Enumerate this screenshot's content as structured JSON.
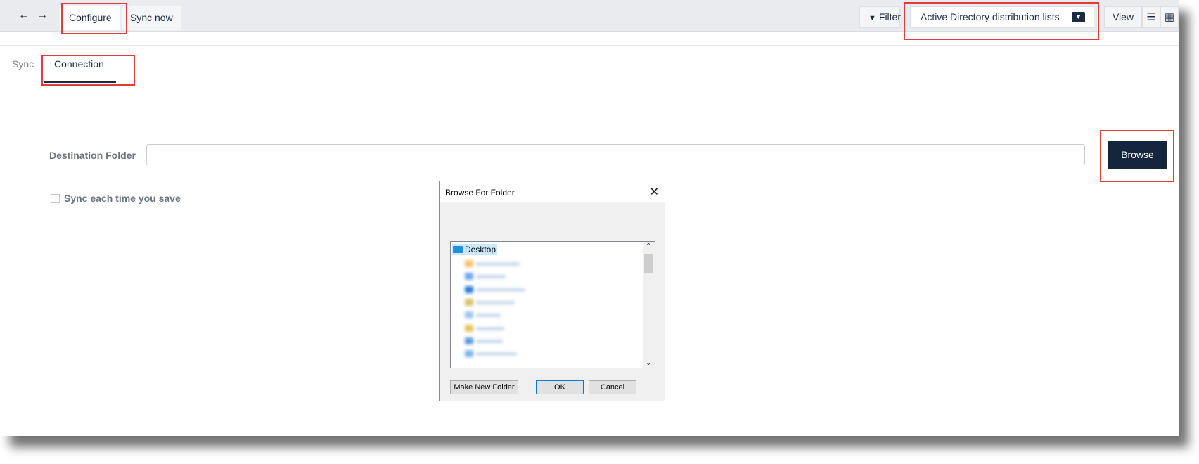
{
  "toolbar": {
    "back_icon": "arrow-left-icon",
    "forward_icon": "arrow-right-icon",
    "configure_label": "Configure",
    "sync_now_label": "Sync now",
    "filter_label": "Filter",
    "view_selector_value": "Active Directory distribution lists",
    "view_label": "View"
  },
  "tabs": [
    {
      "label": "Sync",
      "active": false
    },
    {
      "label": "Connection",
      "active": true
    }
  ],
  "form": {
    "destination_label": "Destination Folder",
    "destination_value": "",
    "browse_label": "Browse",
    "sync_checkbox_label": "Sync each time you save",
    "sync_checked": false
  },
  "dialog": {
    "title": "Browse For Folder",
    "tree_root": "Desktop",
    "make_new_folder_label": "Make New Folder",
    "ok_label": "OK",
    "cancel_label": "Cancel"
  },
  "colors": {
    "accent": "#15253e",
    "highlight_box": "#e03c3c",
    "selection": "#cce8ff"
  }
}
